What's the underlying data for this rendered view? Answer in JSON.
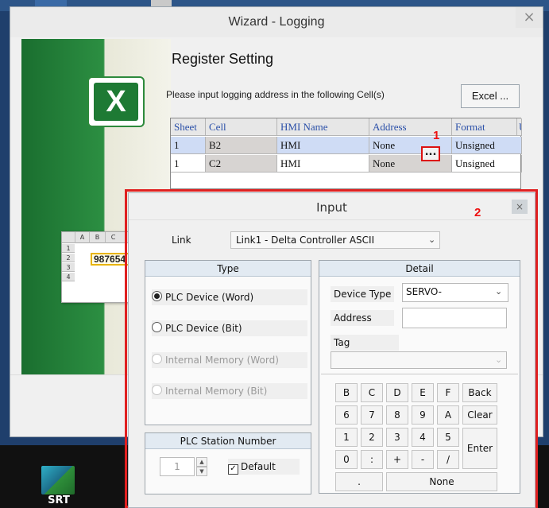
{
  "wizard": {
    "title": "Wizard - Logging",
    "close": "×",
    "heading": "Register Setting",
    "instruction": "Please input logging address in the following Cell(s)",
    "excel_button": "Excel ...",
    "columns": [
      "Sheet",
      "Cell",
      "HMI Name",
      "Address",
      "Format",
      "U"
    ],
    "rows": [
      {
        "sheet": "1",
        "cell": "B2",
        "hmi": "HMI",
        "address": "None",
        "format": "Unsigned"
      },
      {
        "sheet": "1",
        "cell": "C2",
        "hmi": "HMI",
        "address": "None",
        "format": "Unsigned"
      }
    ],
    "browse_button": "...",
    "marker_1": "1",
    "marker_2": "2"
  },
  "excel_art": {
    "logo_letter": "X",
    "sheet_cols": [
      "A",
      "B",
      "C"
    ],
    "sheet_rows": [
      "1",
      "2",
      "3",
      "4"
    ],
    "sheet_value": "987654"
  },
  "taskbar": {
    "srt_label": "SRT"
  },
  "input_dialog": {
    "title": "Input",
    "close": "×",
    "link_label": "Link",
    "link_value": "Link1 - Delta Controller ASCII",
    "type_header": "Type",
    "type_options": [
      {
        "label": "PLC Device (Word)",
        "selected": true,
        "enabled": true
      },
      {
        "label": "PLC Device (Bit)",
        "selected": false,
        "enabled": true
      },
      {
        "label": "Internal Memory (Word)",
        "selected": false,
        "enabled": false
      },
      {
        "label": "Internal Memory (Bit)",
        "selected": false,
        "enabled": false
      }
    ],
    "detail_header": "Detail",
    "device_type_label": "Device Type",
    "device_type_value": "SERVO-",
    "address_label": "Address",
    "address_value": "",
    "tag_label": "Tag",
    "tag_value": "",
    "keys_row1": [
      "B",
      "C",
      "D",
      "E",
      "F",
      "Back"
    ],
    "keys_row2": [
      "6",
      "7",
      "8",
      "9",
      "A",
      "Clear"
    ],
    "keys_row3": [
      "1",
      "2",
      "3",
      "4",
      "5"
    ],
    "keys_row4": [
      "0",
      ":",
      "+",
      "-",
      "/"
    ],
    "enter_key": "Enter",
    "dot_key": ".",
    "none_key": "None",
    "station_header": "PLC Station Number",
    "station_value": "1",
    "default_label": "Default",
    "default_checked": true
  }
}
